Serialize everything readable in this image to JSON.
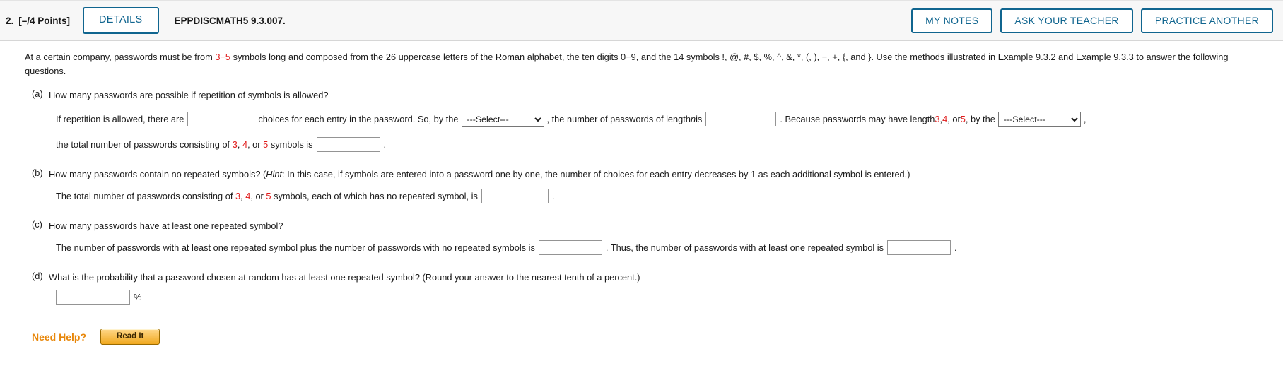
{
  "header": {
    "question_number": "2.",
    "points": "[–/4 Points]",
    "details_label": "DETAILS",
    "question_code": "EPPDISCMATH5 9.3.007.",
    "my_notes_label": "MY NOTES",
    "ask_teacher_label": "ASK YOUR TEACHER",
    "practice_another_label": "PRACTICE ANOTHER",
    "accent_color": "#10658f"
  },
  "stem": {
    "t1": "At a certain company, passwords must be from ",
    "range": "3−5",
    "t2": " symbols long and composed from the 26 uppercase letters of the Roman alphabet, the ten digits 0−9, and the 14 symbols !, @, #, $, %, ^, &, *, (, ), −, +, {, and }. Use the methods illustrated in Example 9.3.2 and Example 9.3.3 to answer the following questions."
  },
  "parts": {
    "a": {
      "label": "(a)",
      "question": "How many passwords are possible if repetition of symbols is allowed?",
      "line1_t1": "If repetition is allowed, there are",
      "line1_t2": "choices for each entry in the password. So, by the",
      "line1_t3": ", the number of passwords of length",
      "line1_n": "n",
      "line1_t4": "is",
      "line1_t5": ". Because passwords may have length",
      "len_3": "3",
      "comma1": ",",
      "len_4": "4",
      "comma2": ", or",
      "len_5": "5",
      "line1_t6": ", by the",
      "line1_t7": ",",
      "line2_t1": "the total number of passwords consisting of",
      "line2_len3": "3",
      "line2_comma1": ",",
      "line2_len4": "4",
      "line2_comma2": ", or",
      "line2_len5": "5",
      "line2_t2": "symbols is",
      "line2_t3": ".",
      "select_placeholder": "---Select---",
      "input_value": ""
    },
    "b": {
      "label": "(b)",
      "question_t1": "How many passwords contain no repeated symbols? (",
      "hint_word": "Hint",
      "question_t2": ": In this case, if symbols are entered into a password one by one, the number of choices for each entry decreases by 1 as each additional symbol is entered.)",
      "line_t1": "The total number of passwords consisting of",
      "len_3": "3",
      "comma1": ",",
      "len_4": "4",
      "comma2": ", or",
      "len_5": "5",
      "line_t2": "symbols, each of which has no repeated symbol, is",
      "line_t3": ".",
      "input_value": ""
    },
    "c": {
      "label": "(c)",
      "question": "How many passwords have at least one repeated symbol?",
      "line_t1": "The number of passwords with at least one repeated symbol plus the number of passwords with no repeated symbols is",
      "line_t2": ". Thus, the number of passwords with at least one repeated symbol is",
      "line_t3": ".",
      "input_value": ""
    },
    "d": {
      "label": "(d)",
      "question": "What is the probability that a password chosen at random has at least one repeated symbol? (Round your answer to the nearest tenth of a percent.)",
      "percent": "%",
      "input_value": ""
    }
  },
  "need_help": {
    "label": "Need Help?",
    "read_it_label": "Read It",
    "label_color": "#e8870a"
  }
}
